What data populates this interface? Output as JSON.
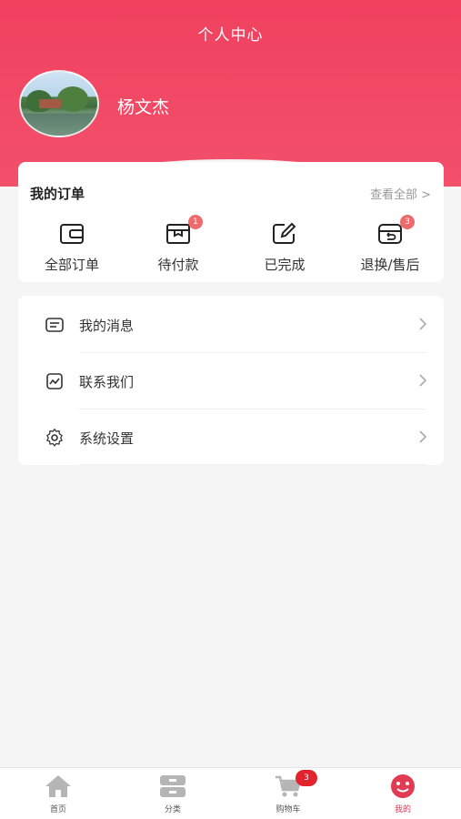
{
  "header": {
    "title": "个人中心",
    "username": "杨文杰",
    "accent": "#f0415f"
  },
  "orders": {
    "title": "我的订单",
    "view_all": "查看全部 >",
    "items": [
      {
        "label": "全部订单",
        "icon": "wallet-icon",
        "badge": ""
      },
      {
        "label": "待付款",
        "icon": "package-icon",
        "badge": "1"
      },
      {
        "label": "已完成",
        "icon": "edit-icon",
        "badge": ""
      },
      {
        "label": "退换/售后",
        "icon": "return-box-icon",
        "badge": "3"
      }
    ]
  },
  "menu": {
    "items": [
      {
        "label": "我的消息",
        "icon": "message-icon"
      },
      {
        "label": "联系我们",
        "icon": "contact-icon"
      },
      {
        "label": "系统设置",
        "icon": "gear-icon"
      }
    ]
  },
  "tabbar": {
    "items": [
      {
        "label": "首页",
        "icon": "home-icon"
      },
      {
        "label": "分类",
        "icon": "category-icon"
      },
      {
        "label": "购物车",
        "icon": "cart-icon",
        "badge": "3"
      },
      {
        "label": "我的",
        "icon": "smiley-icon",
        "active": true
      }
    ]
  }
}
